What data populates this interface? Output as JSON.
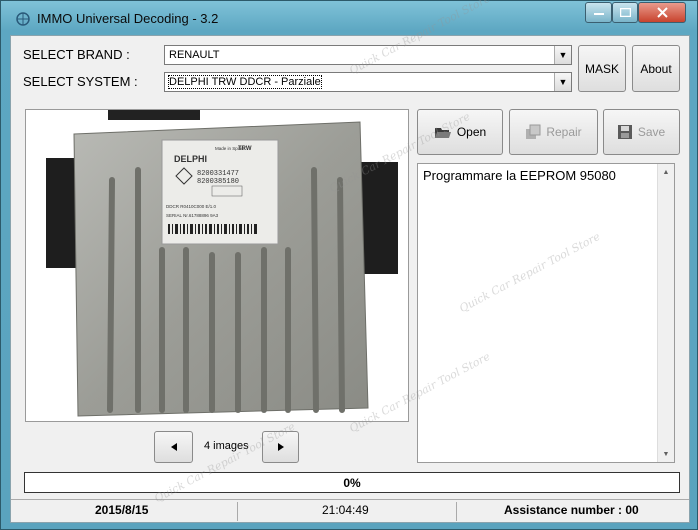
{
  "window": {
    "title": "IMMO Universal Decoding - 3.2"
  },
  "brand": {
    "label": "SELECT BRAND :",
    "value": "RENAULT"
  },
  "system": {
    "label": "SELECT SYSTEM :",
    "value": "DELPHI TRW DDCR - Parziale"
  },
  "buttons": {
    "mask": "MASK",
    "about": "About",
    "open": "Open",
    "repair": "Repair",
    "save": "Save"
  },
  "ecu_label": {
    "brand_top": "Made in Spain",
    "brand_right": "TRW",
    "brand": "DELPHI",
    "part1": "8200331477",
    "part2": "8200385180",
    "code": "DDCR  R0410C000  E/1.0",
    "serial": "SERIAL Nr.61788896 9A3"
  },
  "gallery": {
    "count_text": "4 images"
  },
  "output": {
    "text": "Programmare la EEPROM 95080"
  },
  "progress": {
    "value": 0,
    "text": "0%"
  },
  "status": {
    "date": "2015/8/15",
    "time": "21:04:49",
    "assistance": "Assistance number : 00"
  },
  "watermark": "Quick Car Repair Tool Store"
}
